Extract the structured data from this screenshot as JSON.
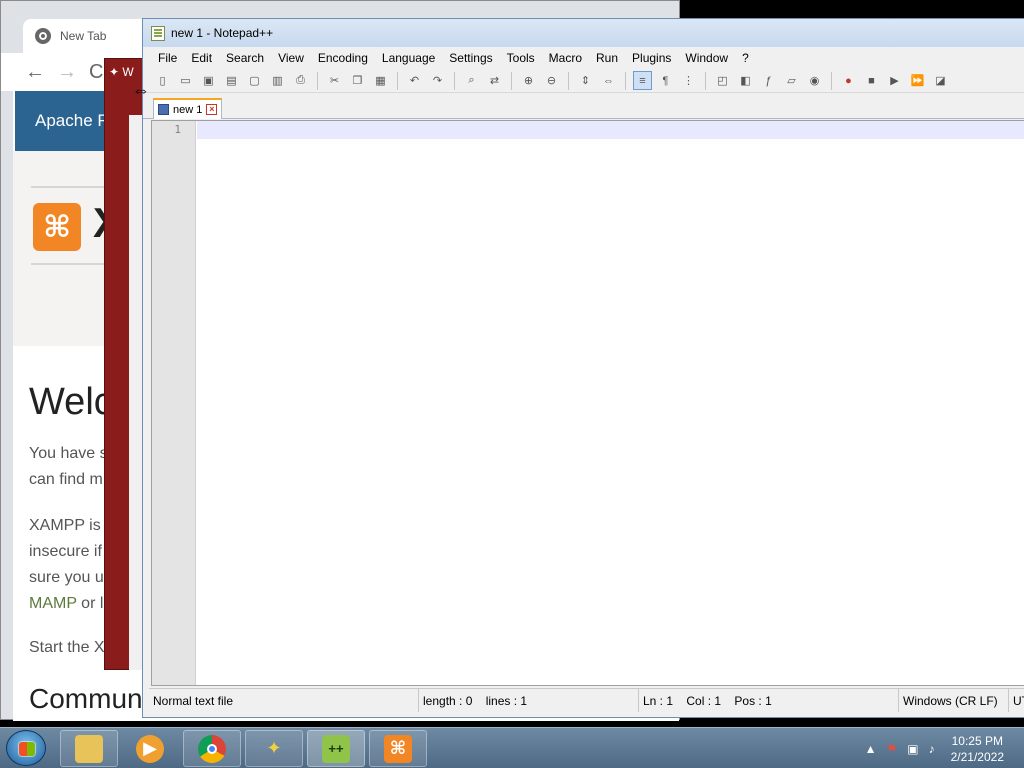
{
  "browser": {
    "tab_title": "New Tab",
    "nav_back": "←",
    "nav_forward": "→",
    "nav_reload": "C",
    "header_text": "Apache F",
    "logo_symbol": "⌘",
    "logo_text": "X",
    "welcome": "Welc",
    "para1_line1": "You have s",
    "para1_line2": "can find m",
    "para2_line1": "XAMPP is",
    "para2_line2": "insecure if",
    "para2_line3": "sure you u",
    "para2_link": "MAMP",
    "para2_line4_rest": " or l",
    "para3": "Start the X",
    "community": "Communi"
  },
  "wizard": {
    "title_partial": "W"
  },
  "notepad": {
    "window_title": "new 1 - Notepad++",
    "menu": [
      "File",
      "Edit",
      "Search",
      "View",
      "Encoding",
      "Language",
      "Settings",
      "Tools",
      "Macro",
      "Run",
      "Plugins",
      "Window",
      "?"
    ],
    "toolbar_icons": [
      "new-file-icon",
      "open-file-icon",
      "save-icon",
      "save-all-icon",
      "close-icon",
      "close-all-icon",
      "print-icon",
      "cut-icon",
      "copy-icon",
      "paste-icon",
      "undo-icon",
      "redo-icon",
      "find-icon",
      "replace-icon",
      "zoom-in-icon",
      "zoom-out-icon",
      "sync-vertical-icon",
      "sync-horizontal-icon",
      "word-wrap-icon",
      "show-all-chars-icon",
      "indent-guide-icon",
      "udl-icon",
      "doc-map-icon",
      "function-list-icon",
      "folder-workspace-icon",
      "monitoring-icon",
      "record-macro-icon",
      "stop-record-icon",
      "play-macro-icon",
      "run-macro-multiple-icon",
      "save-macro-icon"
    ],
    "doc_tab": "new 1",
    "line_number": "1",
    "status": {
      "file_type": "Normal text file",
      "length": "length : 0",
      "lines": "lines : 1",
      "ln": "Ln : 1",
      "col": "Col : 1",
      "pos": "Pos : 1",
      "eol": "Windows (CR LF)",
      "encoding": "UT"
    }
  },
  "taskbar": {
    "pinned": [
      "explorer-icon",
      "media-player-icon",
      "chrome-icon",
      "wizard-icon",
      "notepad-plus-plus-icon",
      "xampp-icon"
    ],
    "clock_time": "10:25 PM",
    "clock_date": "2/21/2022"
  }
}
